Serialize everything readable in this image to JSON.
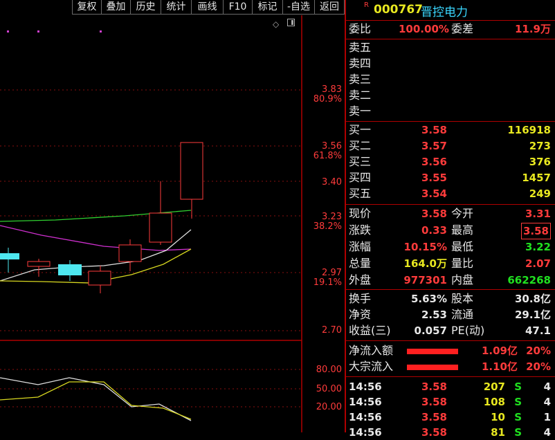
{
  "toolbar": {
    "buttons": [
      "复权",
      "叠加",
      "历史",
      "统计",
      "画线",
      "F10",
      "标记",
      "-自选",
      "返回"
    ]
  },
  "chart": {
    "price_labels": [
      "3.83",
      "3.56",
      "3.40",
      "3.23",
      "2.97",
      "2.70"
    ],
    "pct_labels": [
      "80.9%",
      "61.8%",
      "38.2%",
      "19.1%"
    ],
    "indicator_labels": [
      "80.00",
      "50.00",
      "20.00"
    ],
    "corner_icons": [
      "diamond-icon",
      "panel-toggle-icon"
    ]
  },
  "stock": {
    "flag": "R",
    "code": "000767",
    "name": "晋控电力"
  },
  "order_summary": {
    "ratio_label": "委比",
    "ratio_value": "100.00%",
    "diff_label": "委差",
    "diff_value": "11.9万"
  },
  "asks": [
    {
      "label": "卖五"
    },
    {
      "label": "卖四"
    },
    {
      "label": "卖三"
    },
    {
      "label": "卖二"
    },
    {
      "label": "卖一"
    }
  ],
  "bids": [
    {
      "label": "买一",
      "price": "3.58",
      "vol": "116918"
    },
    {
      "label": "买二",
      "price": "3.57",
      "vol": "273"
    },
    {
      "label": "买三",
      "price": "3.56",
      "vol": "376"
    },
    {
      "label": "买四",
      "price": "3.55",
      "vol": "1457"
    },
    {
      "label": "买五",
      "price": "3.54",
      "vol": "249"
    }
  ],
  "quote": [
    {
      "l1": "现价",
      "v1": "3.58",
      "c1": "#ff3b3b",
      "l2": "今开",
      "v2": "3.31",
      "c2": "#ff3b3b"
    },
    {
      "l1": "涨跌",
      "v1": "0.33",
      "c1": "#ff3b3b",
      "l2": "最高",
      "v2": "3.58",
      "c2": "#ff3b3b"
    },
    {
      "l1": "涨幅",
      "v1": "10.15%",
      "c1": "#ff3b3b",
      "l2": "最低",
      "v2": "3.22",
      "c2": "#20e020"
    },
    {
      "l1": "总量",
      "v1": "164.0万",
      "c1": "#e8e820",
      "l2": "量比",
      "v2": "2.07",
      "c2": "#ff3b3b"
    },
    {
      "l1": "外盘",
      "v1": "977301",
      "c1": "#ff3b3b",
      "l2": "内盘",
      "v2": "662268",
      "c2": "#20e020"
    }
  ],
  "fundamentals": [
    {
      "l1": "换手",
      "v1": "5.63%",
      "l2": "股本",
      "v2": "30.8亿"
    },
    {
      "l1": "净资",
      "v1": "2.53",
      "l2": "流通",
      "v2": "29.1亿"
    },
    {
      "l1": "收益(三)",
      "v1": "0.057",
      "l2": "PE(动)",
      "v2": "47.1"
    }
  ],
  "flows": [
    {
      "label": "净流入额",
      "value": "1.09亿",
      "pct": "20%",
      "bar": 1.0
    },
    {
      "label": "大宗流入",
      "value": "1.10亿",
      "pct": "20%",
      "bar": 1.0
    }
  ],
  "ticks": [
    {
      "time": "14:56",
      "price": "3.58",
      "vol": "207",
      "side": "S",
      "n": "4"
    },
    {
      "time": "14:56",
      "price": "3.58",
      "vol": "108",
      "side": "S",
      "n": "4"
    },
    {
      "time": "14:56",
      "price": "3.58",
      "vol": "10",
      "side": "S",
      "n": "1"
    },
    {
      "time": "14:56",
      "price": "3.58",
      "vol": "81",
      "side": "S",
      "n": "4"
    }
  ],
  "colors": {
    "up": "#ff3b3b",
    "down": "#20e020",
    "frame": "#b00000",
    "code": "#e8e820",
    "name": "#3ad7ff"
  }
}
